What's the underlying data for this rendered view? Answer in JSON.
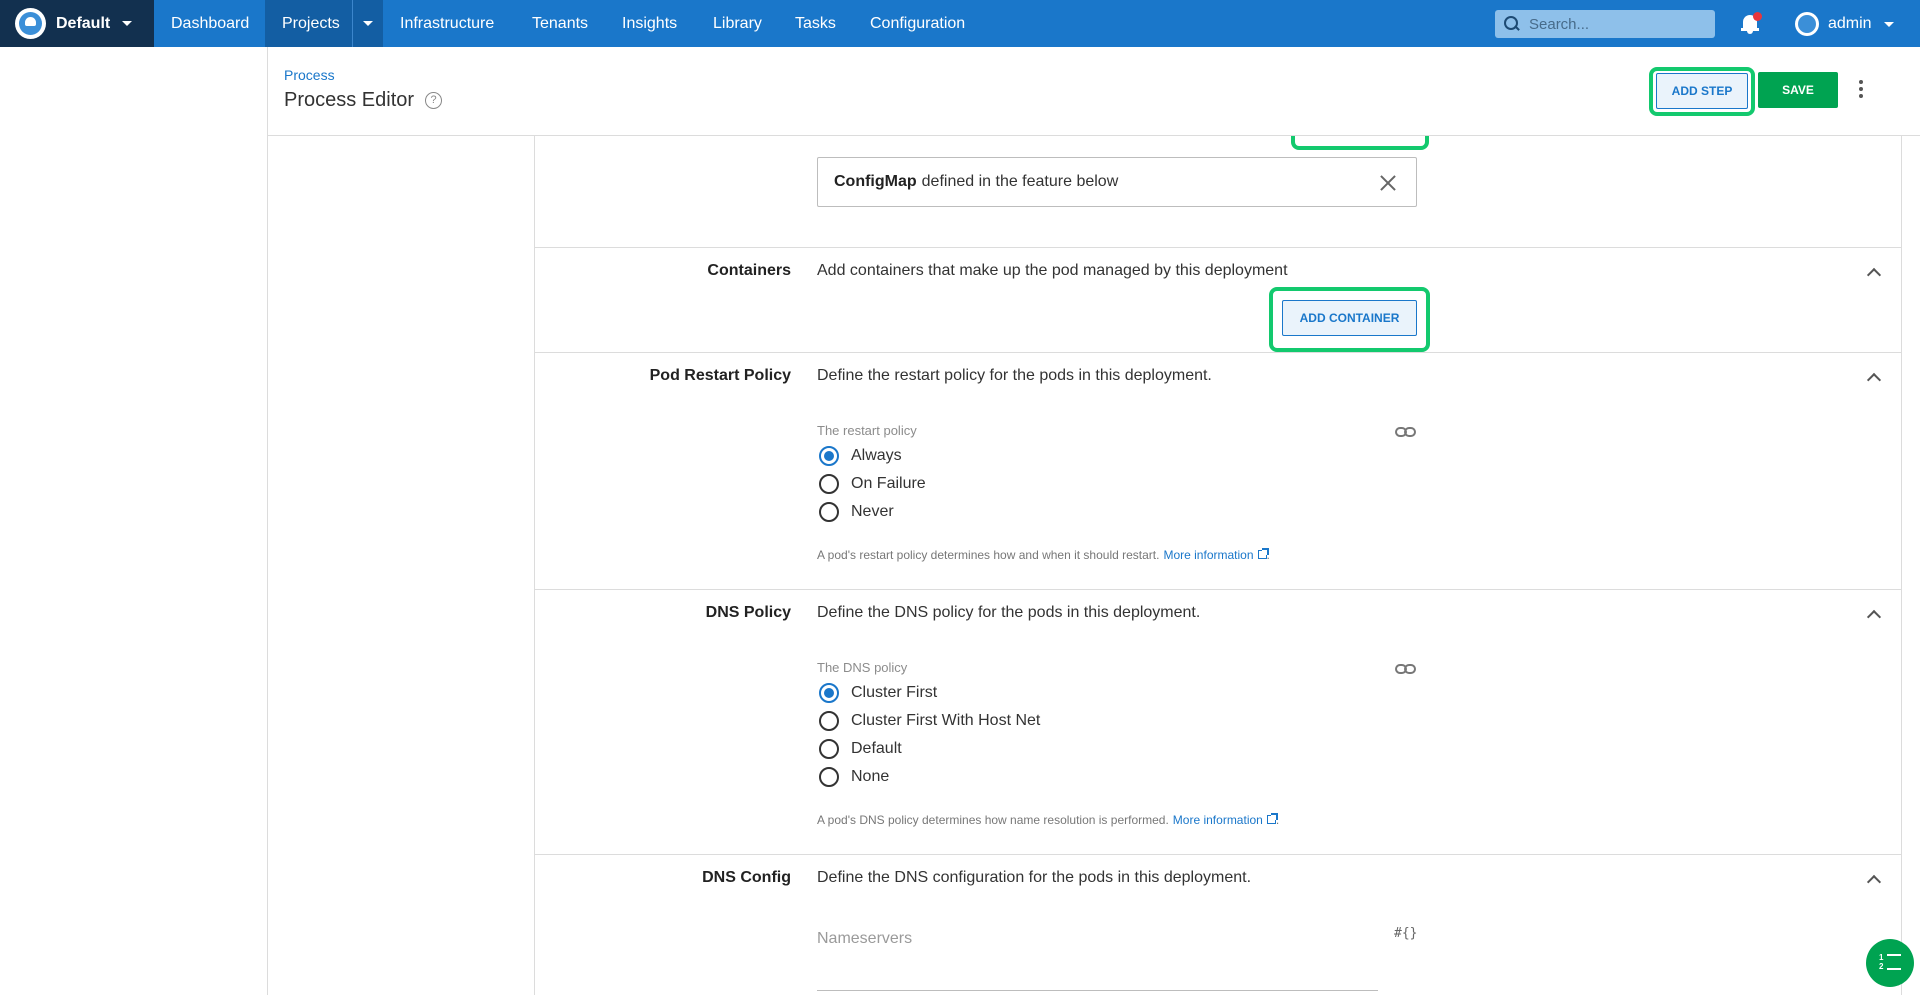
{
  "nav": {
    "space_name": "Default",
    "items": [
      "Dashboard",
      "Projects",
      "Infrastructure",
      "Tenants",
      "Insights",
      "Library",
      "Tasks",
      "Configuration"
    ],
    "search_placeholder": "Search...",
    "user_name": "admin"
  },
  "header": {
    "breadcrumb": "Process",
    "title": "Process Editor",
    "help_glyph": "?",
    "add_step_label": "ADD STEP",
    "save_label": "SAVE"
  },
  "config_map": {
    "strong": "ConfigMap",
    "rest": "defined in the feature below"
  },
  "containers": {
    "label": "Containers",
    "description": "Add containers that make up the pod managed by this deployment",
    "add_button": "ADD CONTAINER"
  },
  "restart_policy": {
    "label": "Pod Restart Policy",
    "description": "Define the restart policy for the pods in this deployment.",
    "field_label": "The restart policy",
    "options": [
      "Always",
      "On Failure",
      "Never"
    ],
    "selected": "Always",
    "help_text": "A pod's restart policy determines how and when it should restart.",
    "help_link": "More information",
    "help_suffix": "."
  },
  "dns_policy": {
    "label": "DNS Policy",
    "description": "Define the DNS policy for the pods in this deployment.",
    "field_label": "The DNS policy",
    "options": [
      "Cluster First",
      "Cluster First With Host Net",
      "Default",
      "None"
    ],
    "selected": "Cluster First",
    "help_text": "A pod's DNS policy determines how name resolution is performed.",
    "help_link": "More information",
    "help_suffix": "."
  },
  "dns_config": {
    "label": "DNS Config",
    "description": "Define the DNS configuration for the pods in this deployment.",
    "nameservers_placeholder": "Nameservers",
    "variable_glyph": "#{}"
  },
  "colors": {
    "nav_blue": "#1a77ca",
    "space_dark": "#12304f",
    "save_green": "#00a351",
    "highlight_green": "#13c96e"
  },
  "icons": [
    "search-icon",
    "bell-icon",
    "close-icon",
    "chevron-up-icon",
    "link-icon",
    "help-circle-icon",
    "external-link-icon",
    "task-list-icon"
  ]
}
